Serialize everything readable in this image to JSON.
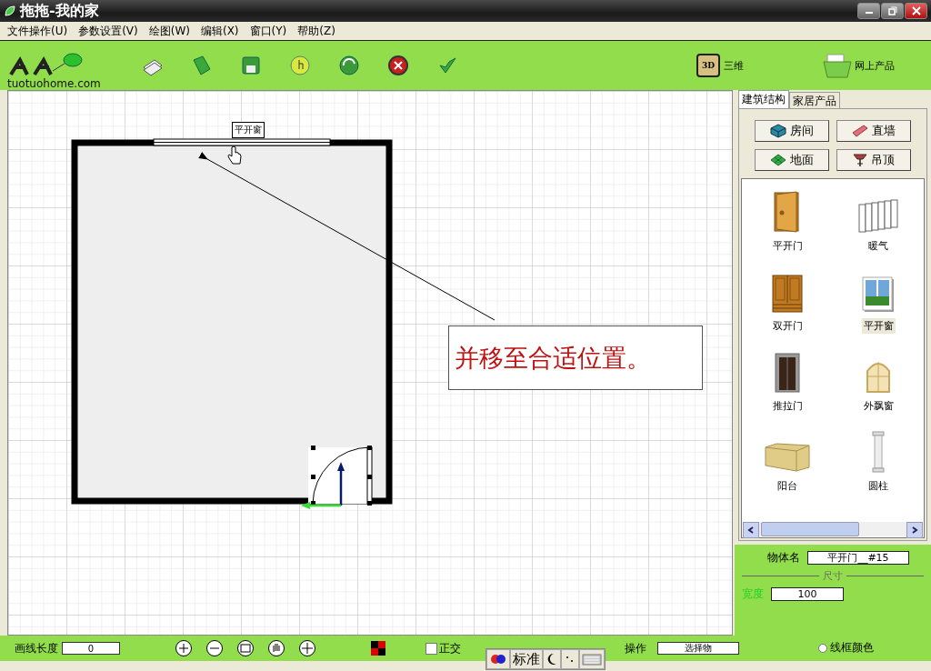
{
  "window": {
    "title": "拖拖-我的家"
  },
  "menu": [
    {
      "label": "文件操作(U)"
    },
    {
      "label": "参数设置(V)"
    },
    {
      "label": "绘图(W)"
    },
    {
      "label": "编辑(X)"
    },
    {
      "label": "窗口(Y)"
    },
    {
      "label": "帮助(Z)"
    }
  ],
  "toolbar": {
    "logo_text": "tuotuohome.com",
    "view_3d": {
      "badge": "3D",
      "label": "三维"
    },
    "online": {
      "label": "网上产品"
    }
  },
  "canvas": {
    "window_label": "平开窗",
    "callout": "并移至合适位置。"
  },
  "panel": {
    "tabs": [
      {
        "label": "建筑结构",
        "selected": true
      },
      {
        "label": "家居产品",
        "selected": false
      }
    ],
    "buttons": [
      {
        "label": "房间",
        "kind": "room"
      },
      {
        "label": "直墙",
        "kind": "wall"
      },
      {
        "label": "地面",
        "kind": "floor"
      },
      {
        "label": "吊顶",
        "kind": "ceiling"
      }
    ],
    "items": [
      {
        "label": "平开门",
        "kind": "door",
        "selected": false
      },
      {
        "label": "暖气",
        "kind": "radiator",
        "selected": false
      },
      {
        "label": "双开门",
        "kind": "double-door",
        "selected": false
      },
      {
        "label": "平开窗",
        "kind": "window",
        "selected": true
      },
      {
        "label": "推拉门",
        "kind": "sliding-door",
        "selected": false
      },
      {
        "label": "外飘窗",
        "kind": "bay-window",
        "selected": false
      },
      {
        "label": "阳台",
        "kind": "balcony",
        "selected": false
      },
      {
        "label": "圆柱",
        "kind": "column",
        "selected": false
      }
    ]
  },
  "properties": {
    "name_label": "物体名",
    "name_value": "平开门__#15",
    "size_legend": "尺寸",
    "width_label": "宽度",
    "width_value": "100",
    "wireframe": {
      "label": "线框颜色",
      "selected": false
    }
  },
  "status_bar": {
    "length_label": "画线长度",
    "length_value": "0",
    "ortho": {
      "label": "正交",
      "checked": false
    },
    "operation_label": "操作",
    "operation_value": "选择物"
  },
  "ime": {
    "mode": "标准"
  }
}
